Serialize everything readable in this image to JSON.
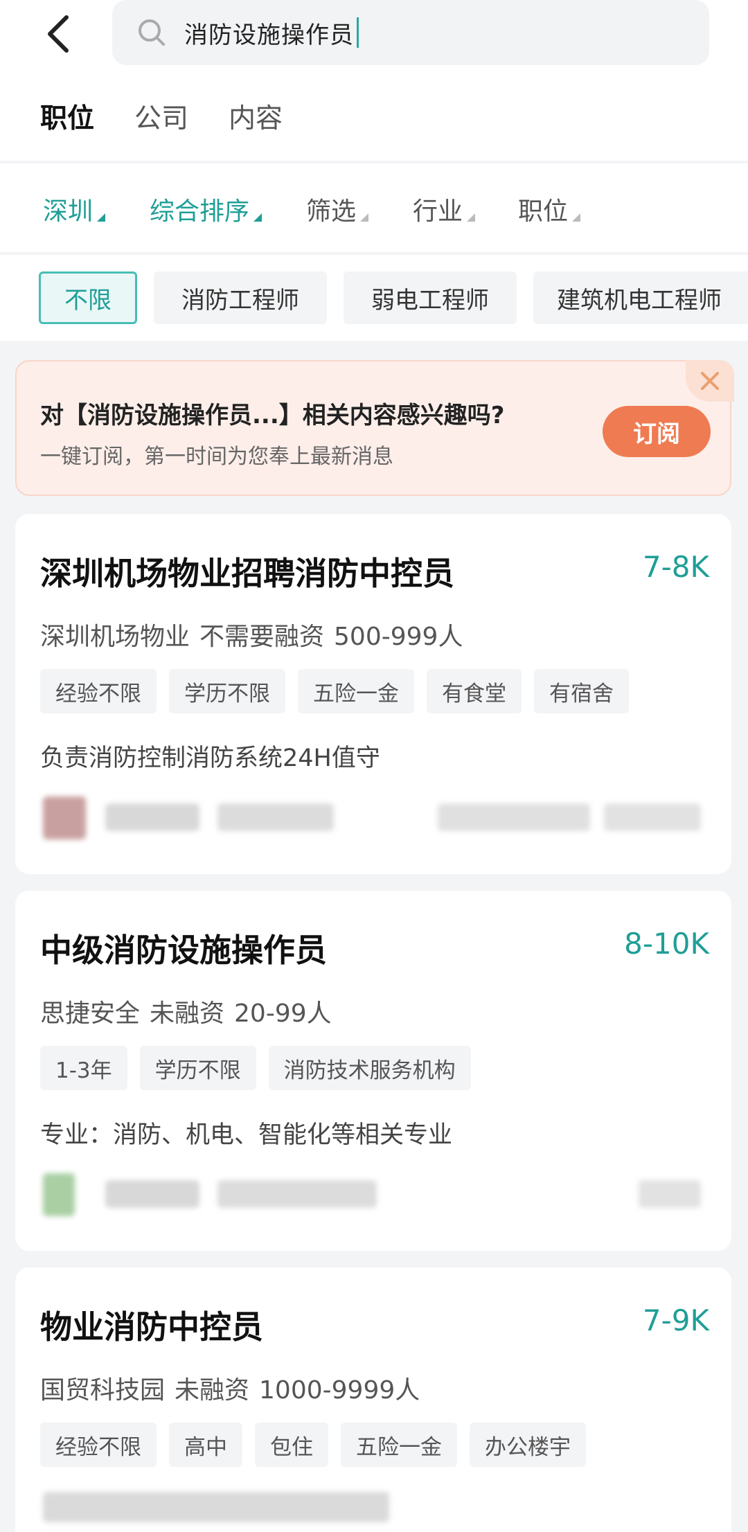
{
  "search": {
    "value": "消防设施操作员"
  },
  "tabs": [
    {
      "label": "职位",
      "active": true
    },
    {
      "label": "公司",
      "active": false
    },
    {
      "label": "内容",
      "active": false
    }
  ],
  "filters": [
    {
      "label": "深圳",
      "active": true
    },
    {
      "label": "综合排序",
      "active": true
    },
    {
      "label": "筛选",
      "active": false
    },
    {
      "label": "行业",
      "active": false
    },
    {
      "label": "职位",
      "active": false
    }
  ],
  "chips": [
    "不限",
    "消防工程师",
    "弱电工程师",
    "建筑机电工程师"
  ],
  "promo": {
    "title": "对【消防设施操作员...】相关内容感兴趣吗?",
    "subtitle": "一键订阅，第一时间为您奉上最新消息",
    "button": "订阅"
  },
  "jobs": [
    {
      "title": "深圳机场物业招聘消防中控员",
      "salary": "7-8K",
      "company": "深圳机场物业",
      "funding": "不需要融资",
      "size": "500-999人",
      "tags": [
        "经验不限",
        "学历不限",
        "五险一金",
        "有食堂",
        "有宿舍"
      ],
      "description": "负责消防控制消防系统24H值守"
    },
    {
      "title": "中级消防设施操作员",
      "salary": "8-10K",
      "company": "思捷安全",
      "funding": "未融资",
      "size": "20-99人",
      "tags": [
        "1-3年",
        "学历不限",
        "消防技术服务机构"
      ],
      "description": "专业：消防、机电、智能化等相关专业"
    },
    {
      "title": "物业消防中控员",
      "salary": "7-9K",
      "company": "国贸科技园",
      "funding": "未融资",
      "size": "1000-9999人",
      "tags": [
        "经验不限",
        "高中",
        "包住",
        "五险一金",
        "办公楼宇"
      ]
    }
  ],
  "colors": {
    "accent": "#1f9e97",
    "subscribe": "#ef7b52",
    "promo_bg": "#fdeee9"
  }
}
